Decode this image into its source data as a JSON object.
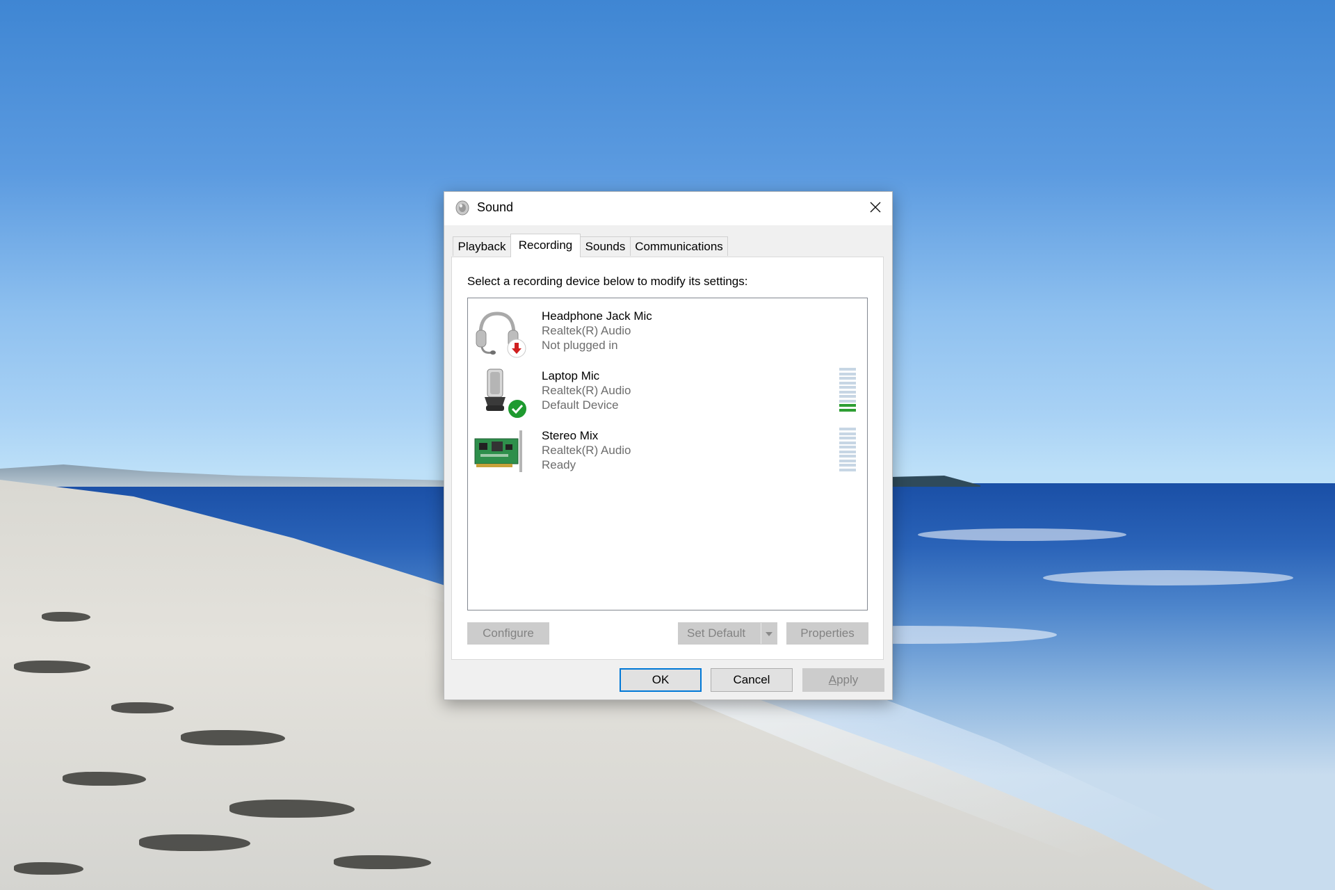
{
  "window": {
    "title": "Sound",
    "close_icon": "close-icon"
  },
  "tabs": [
    {
      "label": "Playback",
      "active": false
    },
    {
      "label": "Recording",
      "active": true
    },
    {
      "label": "Sounds",
      "active": false
    },
    {
      "label": "Communications",
      "active": false
    }
  ],
  "recording": {
    "instruction": "Select a recording device below to modify its settings:",
    "devices": [
      {
        "name": "Headphone Jack Mic",
        "driver": "Realtek(R) Audio",
        "status": "Not plugged in",
        "icon": "headset-icon",
        "badge": "unplugged-badge-icon",
        "level_meter": false
      },
      {
        "name": "Laptop Mic",
        "driver": "Realtek(R) Audio",
        "status": "Default Device",
        "icon": "microphone-icon",
        "badge": "default-check-badge-icon",
        "level_meter": true,
        "level": 0.2
      },
      {
        "name": "Stereo Mix",
        "driver": "Realtek(R) Audio",
        "status": "Ready",
        "icon": "sound-card-icon",
        "level_meter": true,
        "level": 0
      }
    ],
    "buttons": {
      "configure": "Configure",
      "set_default": "Set Default",
      "properties": "Properties"
    }
  },
  "footer": {
    "ok": "OK",
    "cancel": "Cancel",
    "apply": "Apply"
  },
  "colors": {
    "accent": "#0078d7",
    "meter_on": "#2e9e33",
    "meter_off": "#c7d6e4",
    "badge_green": "#1e9a2f",
    "badge_red": "#d01f1f"
  }
}
